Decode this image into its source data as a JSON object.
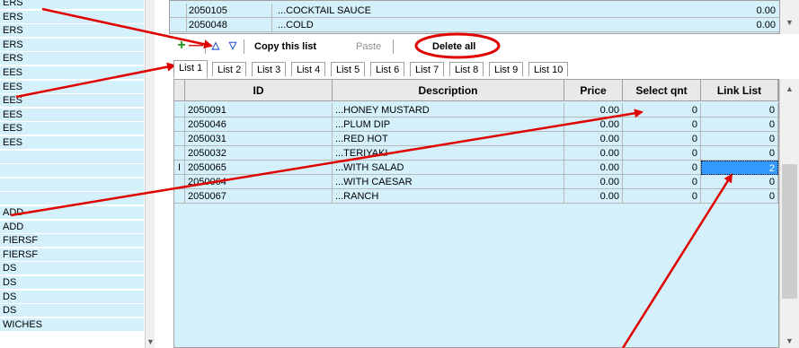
{
  "left_list": {
    "items": [
      "ERS",
      "ERS",
      "ERS",
      "ERS",
      "ERS",
      "EES",
      "EES",
      "EES",
      "EES",
      "EES",
      "EES",
      "",
      "",
      "",
      "",
      "ADD",
      "ADD",
      "FIERSF",
      "FIERSF",
      "DS",
      "DS",
      "DS",
      "DS",
      "WICHES"
    ]
  },
  "top_table": {
    "rows": [
      {
        "id": "2050105",
        "description": "...COCKTAIL SAUCE",
        "price": "0.00"
      },
      {
        "id": "2050048",
        "description": "...COLD",
        "price": "0.00"
      }
    ]
  },
  "toolbar": {
    "add_icon": "plus-icon",
    "remove_icon": "minus-icon",
    "up_icon": "up-triangle-icon",
    "down_icon": "down-triangle-icon",
    "copy_label": "Copy this list",
    "paste_label": "Paste",
    "delete_all_label": "Delete all"
  },
  "tabs": [
    "List 1",
    "List 2",
    "List 3",
    "List 4",
    "List 5",
    "List 6",
    "List 7",
    "List 8",
    "List 9",
    "List 10"
  ],
  "grid": {
    "columns": [
      "ID",
      "Description",
      "Price",
      "Select qnt",
      "Link List"
    ],
    "rows": [
      {
        "id": "2050091",
        "description": "...HONEY MUSTARD",
        "price": "0.00",
        "select_qnt": "0",
        "link_list": "0"
      },
      {
        "id": "2050046",
        "description": "...PLUM DIP",
        "price": "0.00",
        "select_qnt": "0",
        "link_list": "0"
      },
      {
        "id": "2050031",
        "description": "...RED HOT",
        "price": "0.00",
        "select_qnt": "0",
        "link_list": "0"
      },
      {
        "id": "2050032",
        "description": "...TERIYAKI",
        "price": "0.00",
        "select_qnt": "0",
        "link_list": "0"
      },
      {
        "id": "2050065",
        "description": "...WITH SALAD",
        "price": "0.00",
        "select_qnt": "0",
        "link_list": "2"
      },
      {
        "id": "2050064",
        "description": "...WITH CAESAR",
        "price": "0.00",
        "select_qnt": "0",
        "link_list": "0"
      },
      {
        "id": "2050067",
        "description": "...RANCH",
        "price": "0.00",
        "select_qnt": "0",
        "link_list": "0"
      }
    ],
    "edit_cursor": "I"
  },
  "colors": {
    "grid_bg": "#d4f1fb",
    "selected_cell": "#3399ff",
    "annotation_red": "#e00000",
    "add_green": "#1a9a1a",
    "remove_red": "#d02020",
    "arrow_blue": "#2050d0"
  }
}
